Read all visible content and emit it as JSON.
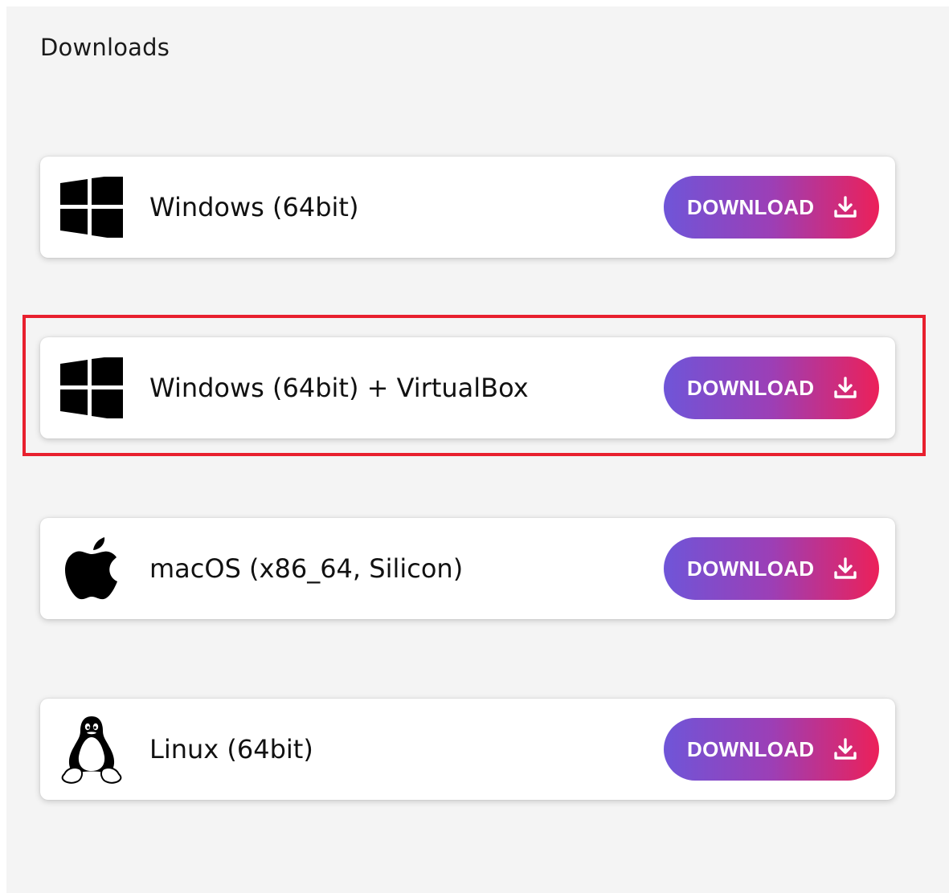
{
  "section": {
    "title": "Downloads"
  },
  "downloads": [
    {
      "os_icon": "windows-icon",
      "label": "Windows (64bit)",
      "button_label": "DOWNLOAD",
      "button_icon": "download-icon"
    },
    {
      "os_icon": "windows-icon",
      "label": "Windows (64bit) + VirtualBox",
      "button_label": "DOWNLOAD",
      "button_icon": "download-icon",
      "highlighted": true
    },
    {
      "os_icon": "apple-icon",
      "label": "macOS (x86_64, Silicon)",
      "button_label": "DOWNLOAD",
      "button_icon": "download-icon"
    },
    {
      "os_icon": "linux-tux-icon",
      "label": "Linux (64bit)",
      "button_label": "DOWNLOAD",
      "button_icon": "download-icon"
    }
  ],
  "colors": {
    "background": "#f4f4f4",
    "card": "#ffffff",
    "button_gradient_start": "#6f55d8",
    "button_gradient_mid": "#9c3fb6",
    "button_gradient_end": "#ec2059",
    "highlight_border": "#e8202e",
    "text": "#111111"
  }
}
